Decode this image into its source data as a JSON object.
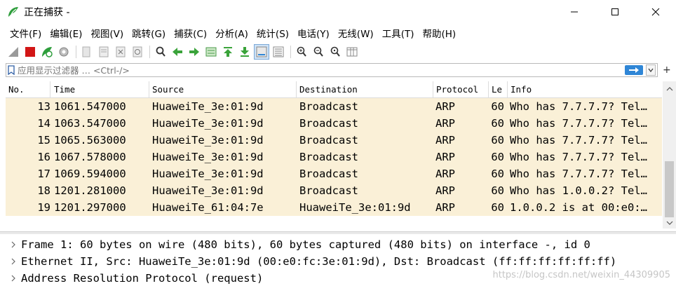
{
  "window": {
    "title": "正在捕获 -",
    "minimize_icon": "minimize-icon",
    "maximize_icon": "maximize-icon",
    "close_icon": "close-icon"
  },
  "menu": [
    {
      "label": "文件(F)"
    },
    {
      "label": "编辑(E)"
    },
    {
      "label": "视图(V)"
    },
    {
      "label": "跳转(G)"
    },
    {
      "label": "捕获(C)"
    },
    {
      "label": "分析(A)"
    },
    {
      "label": "统计(S)"
    },
    {
      "label": "电话(Y)"
    },
    {
      "label": "无线(W)"
    },
    {
      "label": "工具(T)"
    },
    {
      "label": "帮助(H)"
    }
  ],
  "filter": {
    "placeholder": "应用显示过滤器 … <Ctrl-/>"
  },
  "packet_list": {
    "columns": [
      "No.",
      "Time",
      "Source",
      "Destination",
      "Protocol",
      "Le",
      "Info"
    ],
    "rows": [
      {
        "no": "13",
        "time": "1061.547000",
        "source": "HuaweiTe_3e:01:9d",
        "destination": "Broadcast",
        "protocol": "ARP",
        "length": "60",
        "info": "Who has 7.7.7.7? Tel…"
      },
      {
        "no": "14",
        "time": "1063.547000",
        "source": "HuaweiTe_3e:01:9d",
        "destination": "Broadcast",
        "protocol": "ARP",
        "length": "60",
        "info": "Who has 7.7.7.7? Tel…"
      },
      {
        "no": "15",
        "time": "1065.563000",
        "source": "HuaweiTe_3e:01:9d",
        "destination": "Broadcast",
        "protocol": "ARP",
        "length": "60",
        "info": "Who has 7.7.7.7? Tel…"
      },
      {
        "no": "16",
        "time": "1067.578000",
        "source": "HuaweiTe_3e:01:9d",
        "destination": "Broadcast",
        "protocol": "ARP",
        "length": "60",
        "info": "Who has 7.7.7.7? Tel…"
      },
      {
        "no": "17",
        "time": "1069.594000",
        "source": "HuaweiTe_3e:01:9d",
        "destination": "Broadcast",
        "protocol": "ARP",
        "length": "60",
        "info": "Who has 7.7.7.7? Tel…"
      },
      {
        "no": "18",
        "time": "1201.281000",
        "source": "HuaweiTe_3e:01:9d",
        "destination": "Broadcast",
        "protocol": "ARP",
        "length": "60",
        "info": "Who has 1.0.0.2? Tel…"
      },
      {
        "no": "19",
        "time": "1201.297000",
        "source": "HuaweiTe_61:04:7e",
        "destination": "HuaweiTe_3e:01:9d",
        "protocol": "ARP",
        "length": "60",
        "info": "1.0.0.2 is at 00:e0:…"
      }
    ],
    "row_color": "#faf0d7"
  },
  "details": [
    {
      "text": "Frame 1: 60 bytes on wire (480 bits), 60 bytes captured (480 bits) on interface -, id 0"
    },
    {
      "text": "Ethernet II, Src: HuaweiTe_3e:01:9d (00:e0:fc:3e:01:9d), Dst: Broadcast (ff:ff:ff:ff:ff:ff)"
    },
    {
      "text": "Address Resolution Protocol (request)"
    }
  ],
  "watermark": "https://blog.csdn.net/weixin_44309905"
}
